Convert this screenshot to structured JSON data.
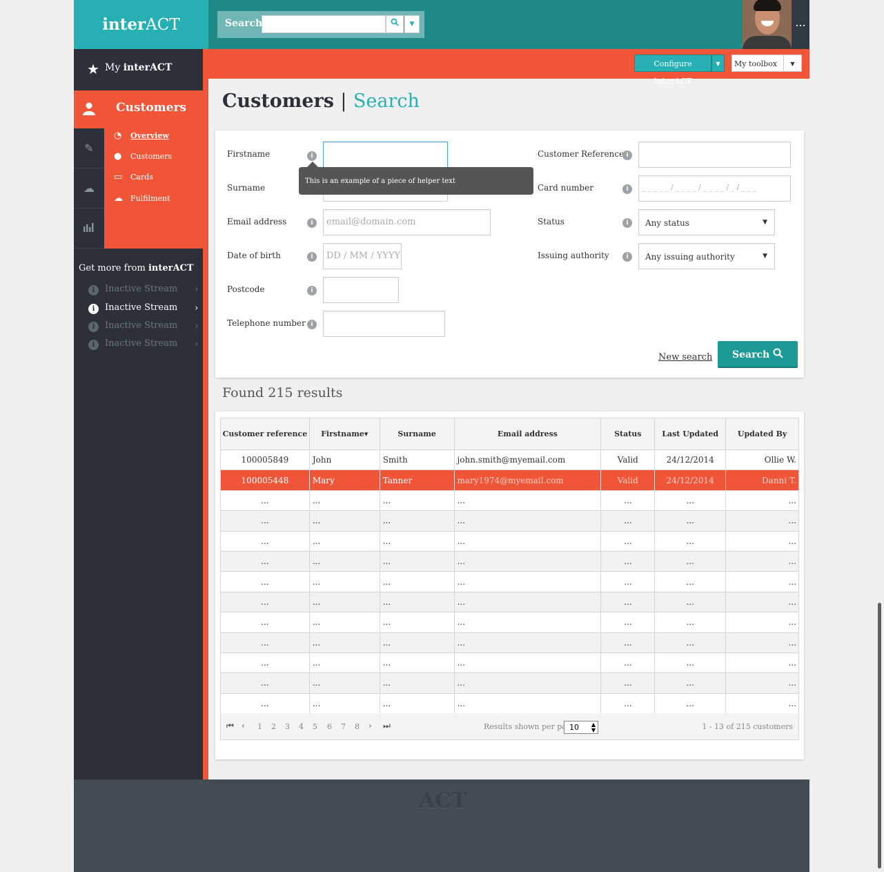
{
  "header": {
    "brand_prefix": "inter",
    "brand_suffix": "ACT",
    "search_label": "Search",
    "search_placeholder": "",
    "search_icon": "search-icon",
    "more_icon": "more-icon",
    "more_text": "..."
  },
  "toolbar": {
    "configure_prefix": "Configure ",
    "configure_bold": "interACT",
    "mytoolbox": "My toolbox"
  },
  "sidebar": {
    "my_prefix": "My ",
    "my_bold": "interACT",
    "section": "Customers",
    "subnav": [
      {
        "label": "Overview",
        "icon": "dashboard-icon"
      },
      {
        "label": "Customers",
        "icon": "user-icon"
      },
      {
        "label": "Cards",
        "icon": "card-icon"
      },
      {
        "label": "Fulfilment",
        "icon": "cloud-download-icon"
      }
    ],
    "getmore_prefix": "Get more from ",
    "getmore_bold": "interACT",
    "streams": [
      "Inactive Stream",
      "Inactive Stream",
      "Inactive Stream",
      "Inactive Stream"
    ]
  },
  "page": {
    "title": "Customers",
    "separator": "|",
    "subtitle": "Search"
  },
  "form": {
    "firstname": "Firstname",
    "surname": "Surname",
    "email": "Email address",
    "email_placeholder": "email@domain.com",
    "dob": "Date of birth",
    "dob_placeholder": "DD / MM / YYYY",
    "postcode": "Postcode",
    "telephone": "Telephone number",
    "custref": "Customer Reference",
    "cardnum": "Card number",
    "cardnum_placeholder": "_ _ _ _ _ / _ _ _ _ / _ _ _ _ / _ / _ _ _",
    "status": "Status",
    "status_value": "Any status",
    "issuing": "Issuing authority",
    "issuing_value": "Any issuing authority",
    "tooltip": "This is an example of a piece of helper text",
    "new_search": "New search",
    "search_button": "Search",
    "info_glyph": "i"
  },
  "results": {
    "found": "Found 215 results",
    "columns": [
      "Customer reference",
      "Firstname",
      "Surname",
      "Email address",
      "Status",
      "Last Updated",
      "Updated By"
    ],
    "sort_indicator": "▾",
    "rows": [
      [
        "100005849",
        "John",
        "Smith",
        "john.smith@myemail.com",
        "Valid",
        "24/12/2014",
        "Ollie W."
      ],
      [
        "100005448",
        "Mary",
        "Tanner",
        "mary1974@myemail.com",
        "Valid",
        "24/12/2014",
        "Danni T."
      ],
      [
        "...",
        "...",
        "...",
        "...",
        "...",
        "...",
        "..."
      ],
      [
        "...",
        "...",
        "...",
        "...",
        "...",
        "...",
        "..."
      ],
      [
        "...",
        "...",
        "...",
        "...",
        "...",
        "...",
        "..."
      ],
      [
        "...",
        "...",
        "...",
        "...",
        "...",
        "...",
        "..."
      ],
      [
        "...",
        "...",
        "...",
        "...",
        "...",
        "...",
        "..."
      ],
      [
        "...",
        "...",
        "...",
        "...",
        "...",
        "...",
        "..."
      ],
      [
        "...",
        "...",
        "...",
        "...",
        "...",
        "...",
        "..."
      ],
      [
        "...",
        "...",
        "...",
        "...",
        "...",
        "...",
        "..."
      ],
      [
        "...",
        "...",
        "...",
        "...",
        "...",
        "...",
        "..."
      ],
      [
        "...",
        "...",
        "...",
        "...",
        "...",
        "...",
        "..."
      ],
      [
        "...",
        "...",
        "...",
        "...",
        "...",
        "...",
        "..."
      ]
    ],
    "pages": [
      "1",
      "2",
      "3",
      "4",
      "5",
      "6",
      "7",
      "8"
    ],
    "per_page_label": "Results shown per page",
    "per_page_value": "10",
    "count": "1 - 13 of 215 customers"
  },
  "footer": {
    "logo": "ACT"
  },
  "colors": {
    "teal": "#26b0b3",
    "dark_teal": "#1e8a87",
    "orange": "#f05538",
    "sidebar": "#2b3039",
    "footer": "#434b54"
  }
}
